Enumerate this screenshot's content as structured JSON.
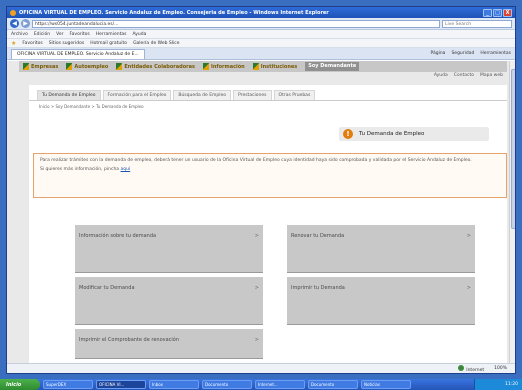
{
  "window": {
    "title": "OFICINA VIRTUAL DE EMPLEO. Servicio Andaluz de Empleo. Consejeria de Empleo - Windows Internet Explorer",
    "buttons": [
      "_",
      "□",
      "X"
    ]
  },
  "address_bar": {
    "url": "https://ws054.juntadeandalucia.es/...",
    "search_placeholder": "Live Search"
  },
  "menu": [
    "Archivo",
    "Edición",
    "Ver",
    "Favoritos",
    "Herramientas",
    "Ayuda"
  ],
  "favorites": {
    "label": "Favoritos",
    "items": [
      "Sitios sugeridos",
      "Hotmail gratuito",
      "Galería de Web Slice"
    ]
  },
  "tab": {
    "label": "OFICINA VIRTUAL DE EMPLEO. Servicio Andaluz de E...",
    "commands": [
      "Página",
      "Seguridad",
      "Herramientas"
    ]
  },
  "site_nav": {
    "items": [
      "Empresas",
      "Autoempleo",
      "Entidades Colaboradoras",
      "Información",
      "Instituciones",
      "Soy Demandante"
    ]
  },
  "util_links": [
    "Ayuda",
    "Contacto",
    "Mapa web"
  ],
  "subtabs": [
    "Tu Demanda de Empleo",
    "Formación para el Empleo",
    "Búsqueda de Empleo",
    "Prestaciones",
    "Otras Pruebas"
  ],
  "breadcrumb": "Inicio > Soy Demandante > Tu Demanda de Empleo",
  "page_title": "Tu Demanda de Empleo",
  "notice": {
    "text": "Para realizar trámites con la demanda de empleo, deberá tener un usuario de la Oficina Virtual de Empleo cuya identidad haya sido comprobada y validada por el Servicio Andaluz de Empleo.",
    "more_prefix": "Si quieres más información, pincha ",
    "more_link": "aquí"
  },
  "cards": [
    {
      "label": "Información sobre tu demanda",
      "arrow": ">"
    },
    {
      "label": "Renovar tu Demanda",
      "arrow": ">"
    },
    {
      "label": "Modificar tu Demanda",
      "arrow": ">"
    },
    {
      "label": "Imprimir tu Demanda",
      "arrow": ">"
    },
    {
      "label": "Imprimir el Comprobante de renovación",
      "arrow": ">"
    }
  ],
  "statusbar": {
    "zone": "Internet",
    "zoom": "100%"
  },
  "taskbar": {
    "start": "Inicio",
    "tasks": [
      "SuperDEX",
      "OFICINA VI...",
      "Inbox",
      "Documento",
      "Internet...",
      "Documento",
      "Noticias"
    ],
    "clock": "11:20"
  },
  "colors": {
    "accent_orange": "#e07d0c",
    "nav_text": "#7a5a00",
    "card_bg": "#c8c8c8",
    "xp_blue": "#2454b8"
  }
}
